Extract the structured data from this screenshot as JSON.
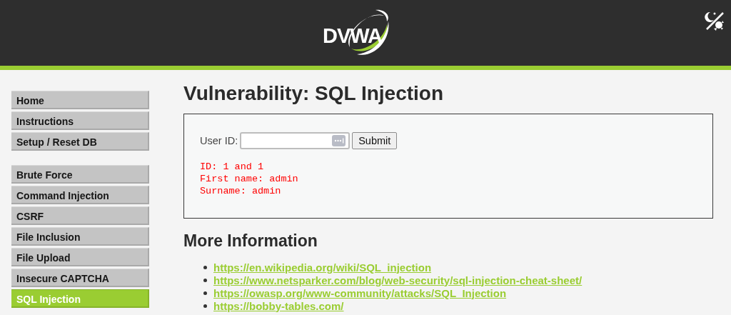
{
  "header": {
    "logo": "DVWA"
  },
  "sidebar": {
    "groups": [
      [
        {
          "label": "Home",
          "selected": false
        },
        {
          "label": "Instructions",
          "selected": false
        },
        {
          "label": "Setup / Reset DB",
          "selected": false
        }
      ],
      [
        {
          "label": "Brute Force",
          "selected": false
        },
        {
          "label": "Command Injection",
          "selected": false
        },
        {
          "label": "CSRF",
          "selected": false
        },
        {
          "label": "File Inclusion",
          "selected": false
        },
        {
          "label": "File Upload",
          "selected": false
        },
        {
          "label": "Insecure CAPTCHA",
          "selected": false
        },
        {
          "label": "SQL Injection",
          "selected": true
        }
      ]
    ]
  },
  "page": {
    "title": "Vulnerability: SQL Injection",
    "form": {
      "label": "User ID:",
      "button": "Submit"
    },
    "result": [
      "ID: 1 and 1",
      "First name: admin",
      "Surname: admin"
    ],
    "more_heading": "More Information",
    "links": [
      "https://en.wikipedia.org/wiki/SQL_injection",
      "https://www.netsparker.com/blog/web-security/sql-injection-cheat-sheet/",
      "https://owasp.org/www-community/attacks/SQL_Injection",
      "https://bobby-tables.com/"
    ]
  }
}
